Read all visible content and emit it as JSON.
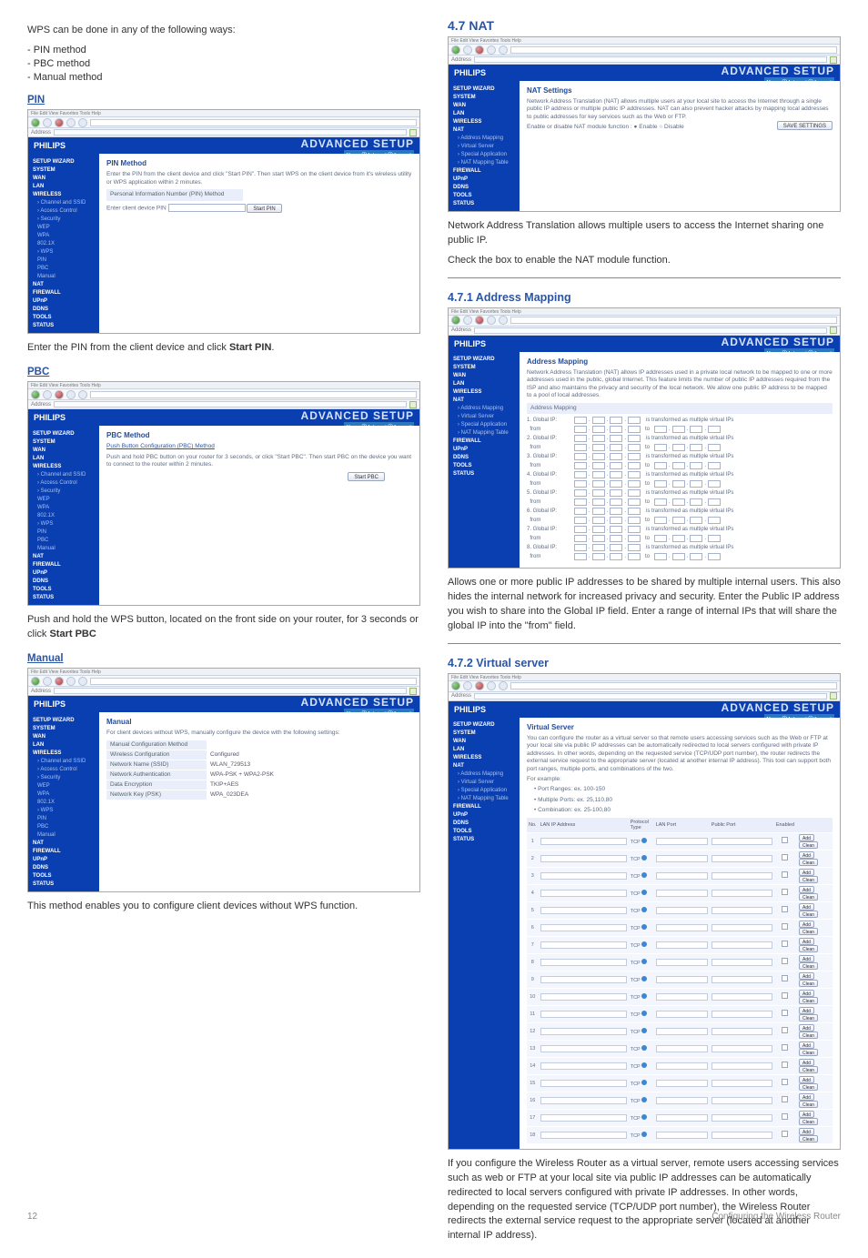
{
  "left": {
    "intro": "WPS can be done in any of the following ways:",
    "bullet1": "- PIN method",
    "bullet2": "- PBC method",
    "bullet3": "- Manual method",
    "pin_heading": "PIN",
    "pin_caption": "Enter the PIN from the client device and click Start PIN.",
    "pbc_heading": "PBC",
    "pbc_caption": "Push and hold the WPS button, located on the front side on your router, for 3 seconds or click Start PBC",
    "manual_heading": "Manual",
    "manual_caption": "This method enables you to configure client devices without WPS function."
  },
  "right": {
    "sec47": "4.7   NAT",
    "nat_caption1": "Network Address Translation allows multiple users to access the Internet sharing one public IP.",
    "nat_caption2": "Check the box to enable the NAT module function.",
    "sec471": "4.7.1  Address Mapping",
    "am_caption": "Allows one or more public IP addresses to be shared by multiple internal users. This also hides the internal network for increased privacy and security. Enter the Public IP address you wish to share into the Global IP field. Enter a range of internal IPs that will share the global IP into the \"from\" field.",
    "sec472": "4.7.2  Virtual server",
    "vs_caption": "If you configure the Wireless Router as a virtual server, remote users accessing services such as web or FTP at your local site via public IP addresses can be automatically redirected to local servers configured with private IP addresses. In other words, depending on the requested service (TCP/UDP port number), the Wireless Router redirects the external service request to the appropriate server (located at another internal IP address)."
  },
  "router": {
    "menubar": "File   Edit   View   Favorites   Tools   Help",
    "brand": "PHILIPS",
    "adv": "ADVANCED SETUP",
    "iso": "Home  ⓘ Internet  ⓘ Logout",
    "nav": {
      "setup_wizard": "SETUP WIZARD",
      "system": "SYSTEM",
      "wan": "WAN",
      "lan": "LAN",
      "wireless": "WIRELESS",
      "ch_ssid": "› Channel and SSID",
      "ac": "› Access Control",
      "sec": "› Security",
      "wep": "WEP",
      "wpa": "WPA",
      "x8021": "802.1X",
      "wps": "› WPS",
      "pin": "PIN",
      "pbc": "PBC",
      "manual": "Manual",
      "nat": "NAT",
      "am": "› Address Mapping",
      "vs": "› Virtual Server",
      "sa": "› Special Application",
      "nmt": "› NAT Mapping Table",
      "firewall": "FIREWALL",
      "upnp": "UPnP",
      "ddns": "DDNS",
      "tools": "TOOLS",
      "status": "STATUS"
    },
    "pin": {
      "title": "PIN Method",
      "desc": "Enter the PIN from the client device and click \"Start PIN\". Then start WPS on the client device from it's wireless utility or WPS application within 2 minutes.",
      "row_label": "Personal Information Number (PIN) Method",
      "input_label": "Enter client device PIN",
      "btn": "Start PIN"
    },
    "pbc": {
      "title": "PBC Method",
      "sub": "Push Button Configuration (PBC) Method",
      "desc": "Push and hold PBC button on your router for 3 seconds, or click \"Start PBC\". Then start PBC on the device you want to connect to the router within 2 minutes.",
      "btn": "Start PBC"
    },
    "manual": {
      "title": "Manual",
      "desc": "For client devices without WPS, manually configure the device with the following settings:",
      "rows": {
        "method": "Manual Configuration Method",
        "wc_k": "Wireless Configuration",
        "wc_v": "Configured",
        "nn_k": "Network Name (SSID)",
        "nn_v": "WLAN_729513",
        "na_k": "Network Authentication",
        "na_v": "WPA-PSK + WPA2-PSK",
        "de_k": "Data Encryption",
        "de_v": "TKIP+AES",
        "nk_k": "Network Key (PSK)",
        "nk_v": "WPA_023DEA"
      }
    },
    "nat": {
      "title": "NAT Settings",
      "desc": "Network Address Translation (NAT) allows multiple users at your local site to access the Internet through a single public IP address or multiple public IP addresses. NAT can also prevent hacker attacks by mapping local addresses to public addresses for key services such as the Web or FTP.",
      "toggle": "Enable or disable NAT module function :   ● Enable   ○ Disable",
      "save": "SAVE SETTINGS"
    },
    "am": {
      "title": "Address Mapping",
      "desc": "Network Address Translation (NAT) allows IP addresses used in a private local network to be mapped to one or more addresses used in the public, global Internet. This feature limits the number of public IP addresses required from the ISP and also maintains the privacy and security of the local network. We allow one public IP address to be mapped to a pool of local addresses.",
      "global_label": "Global IP:",
      "from_label": "from",
      "trans_label": "is transformed as multiple virtual IPs",
      "to_label": "to"
    },
    "vs": {
      "title": "Virtual Server",
      "desc": "You can configure the router as a virtual server so that remote users accessing services such as the Web or FTP at your local site via public IP addresses can be automatically redirected to local servers configured with private IP addresses. In other words, depending on the requested service (TCP/UDP port number), the router redirects the external service request to the appropriate server (located at another internal IP address). This tool can support both port ranges, multiple ports, and combinations of the two.",
      "ex_head": "For example:",
      "ex1": "• Port Ranges: ex. 100-150",
      "ex2": "• Multiple Ports: ex. 25,110,80",
      "ex3": "• Combination: ex. 25-100,80",
      "cols": {
        "no": "No.",
        "lan": "LAN IP Address",
        "proto": "Protocol Type",
        "lp": "LAN Port",
        "pp": "Public Port",
        "en": "Enabled"
      },
      "proto_val": "TCP",
      "add": "Add",
      "clean": "Clean"
    }
  },
  "footer": {
    "page": "12",
    "title": "Configuring the Wireless Router"
  }
}
